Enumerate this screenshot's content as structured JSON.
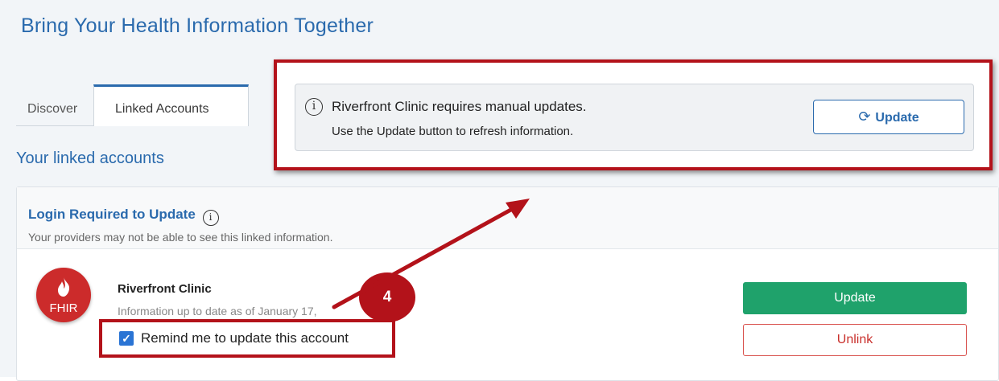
{
  "page": {
    "title": "Bring Your Health Information Together"
  },
  "tabs": [
    {
      "label": "Discover",
      "active": false
    },
    {
      "label": "Linked Accounts",
      "active": true
    }
  ],
  "section": {
    "heading": "Your linked accounts"
  },
  "notice": {
    "line1": "Riverfront Clinic requires manual updates.",
    "line2": "Use the Update button to refresh information.",
    "button_label": "Update",
    "button_icon": "refresh-icon",
    "info_icon": "info-icon"
  },
  "card": {
    "title": "Login Required to Update",
    "description": "Your providers may not be able to see this linked information.",
    "account": {
      "logo_text": "FHIR",
      "name": "Riverfront Clinic",
      "updated": "Information up to date as of January 17,",
      "remind_label": "Remind me to update this account",
      "remind_checked": true
    },
    "update_label": "Update",
    "unlink_label": "Unlink"
  },
  "annotation": {
    "step": "4"
  },
  "colors": {
    "brand": "#2a6aad",
    "highlight": "#b3121a",
    "update_green": "#1fa26b",
    "unlink_red": "#c9302c"
  }
}
